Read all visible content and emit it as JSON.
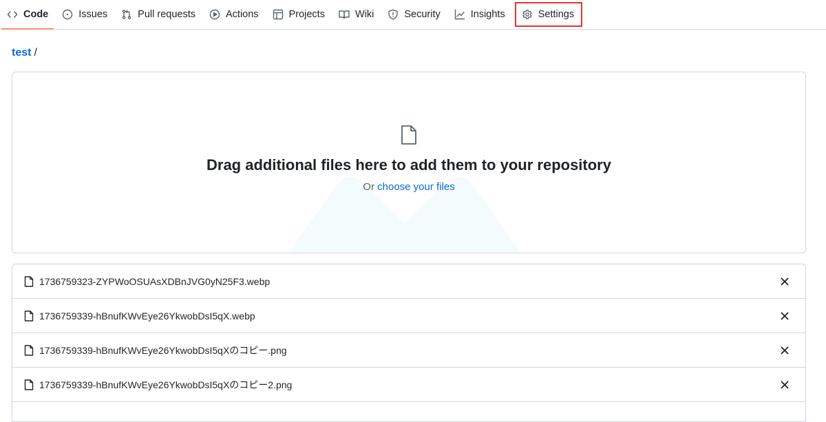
{
  "repo_nav": {
    "items": [
      {
        "label": "Code",
        "icon": "code-icon"
      },
      {
        "label": "Issues",
        "icon": "issue-opened-icon"
      },
      {
        "label": "Pull requests",
        "icon": "git-pull-request-icon"
      },
      {
        "label": "Actions",
        "icon": "play-icon"
      },
      {
        "label": "Projects",
        "icon": "table-icon"
      },
      {
        "label": "Wiki",
        "icon": "book-icon"
      },
      {
        "label": "Security",
        "icon": "shield-icon"
      },
      {
        "label": "Insights",
        "icon": "graph-icon"
      },
      {
        "label": "Settings",
        "icon": "gear-icon"
      }
    ],
    "active": "Code",
    "highlighted": "Settings",
    "active_underline_color": "#fd8c73",
    "highlight_color": "#e5332a"
  },
  "breadcrumb": {
    "repo": "test",
    "separator": "/"
  },
  "dropzone": {
    "icon": "file-icon",
    "title": "Drag additional files here to add them to your repository",
    "prefix": "Or",
    "link": "choose your files"
  },
  "files": [
    {
      "name": "1736759323-ZYPWoOSUAsXDBnJVG0yN25F3.webp",
      "icon": "file-icon",
      "remove_icon": "x-icon"
    },
    {
      "name": "1736759339-hBnufKWvEye26YkwobDsI5qX.webp",
      "icon": "file-icon",
      "remove_icon": "x-icon"
    },
    {
      "name": "1736759339-hBnufKWvEye26YkwobDsI5qXのコピー.png",
      "icon": "file-icon",
      "remove_icon": "x-icon"
    },
    {
      "name": "1736759339-hBnufKWvEye26YkwobDsI5qXのコピー2.png",
      "icon": "file-icon",
      "remove_icon": "x-icon"
    }
  ],
  "colors": {
    "link": "#0969da",
    "text": "#1f2328",
    "muted": "#59636e",
    "border": "#d0d7de"
  }
}
